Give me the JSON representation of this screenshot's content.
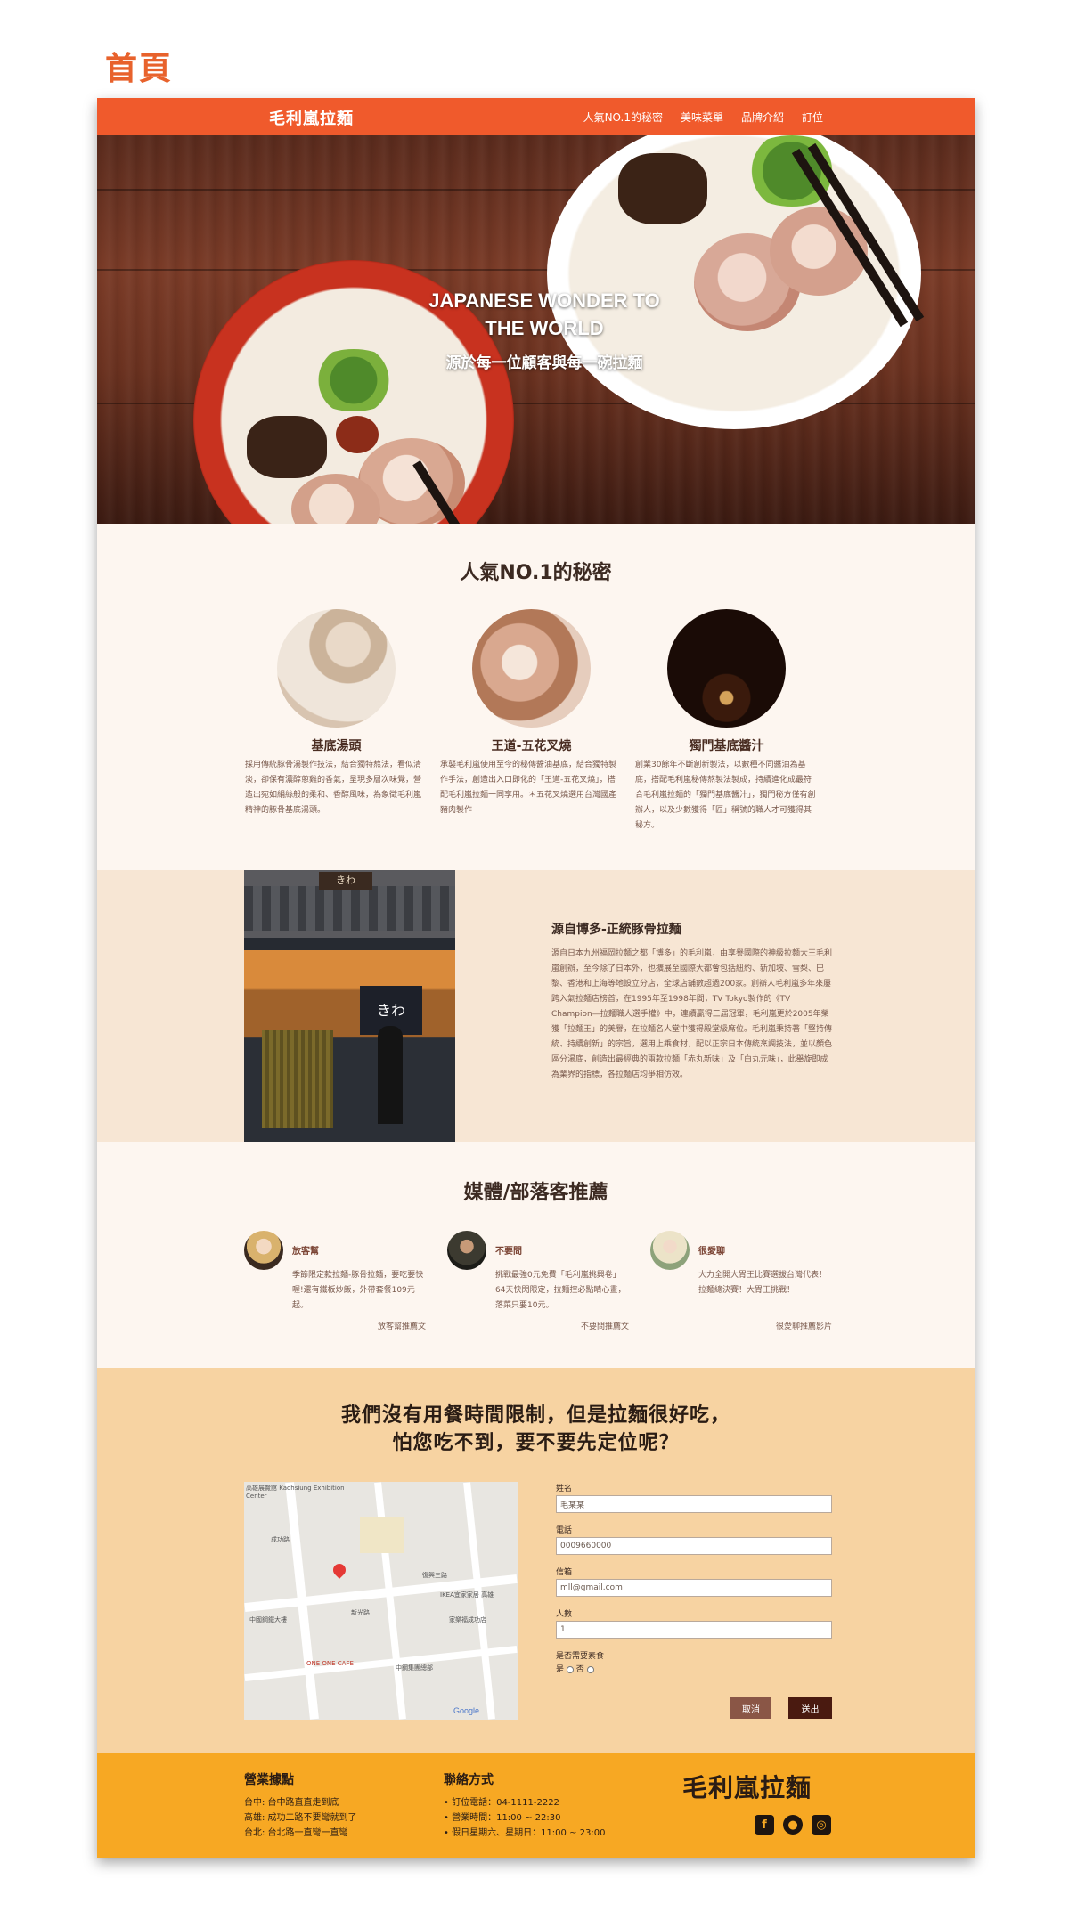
{
  "page_label": "首頁",
  "nav": {
    "brand": "毛利嵐拉麵",
    "items": [
      {
        "label": "人氣NO.1的秘密"
      },
      {
        "label": "美味菜單"
      },
      {
        "label": "品牌介紹"
      },
      {
        "label": "訂位"
      }
    ]
  },
  "hero": {
    "title_line1": "JAPANESE WONDER TO",
    "title_line2": "THE WORLD",
    "subtitle": "源於每一位顧客與每一碗拉麵"
  },
  "secret": {
    "title": "人氣NO.1的秘密",
    "features": [
      {
        "name": "基底湯頭",
        "desc": "採用傳統豚骨湯製作技法，結合獨特熬法，看似清淡，卻保有濃醇蔥雞的香氣，呈現多層次味覺，營造出宛如絹絲般的柔和、香醇風味，為象徵毛利嵐精神的豚骨基底湯頭。"
      },
      {
        "name": "王道-五花叉燒",
        "desc": "承襲毛利嵐使用至今的秘傳醬油基底，結合獨特製作手法，創造出入口即化的「王道-五花叉燒」，搭配毛利嵐拉麵一同享用。＊五花叉燒選用台灣國產豬肉製作"
      },
      {
        "name": "獨門基底醬汁",
        "desc": "創業30餘年不斷創新製法，以數種不同醬油為基底，搭配毛利嵐秘傳熬製法製成，持續進化成最符合毛利嵐拉麵的「獨門基底醬汁」，獨門秘方僅有創辦人，以及少數獲得「匠」稱號的職人才可獲得其秘方。"
      }
    ]
  },
  "story": {
    "shop_sign": "きわ",
    "title": "源自博多-正統豚骨拉麵",
    "text": "源自日本九州福岡拉麵之都「博多」的毛利嵐，由享譽國際的神級拉麵大王毛利嵐創辦，至今除了日本外，也擴展至國際大都會包括紐約、新加坡、雪梨、巴黎、香港和上海等地設立分店，全球店舖數超過200家。創辦人毛利嵐多年來屢跨入氣拉麵店榜首，在1995年至1998年間，TV Tokyo製作的《TV Champion—拉麵職人選手權》中，連續贏得三屆冠軍，毛利嵐更於2005年榮獲「拉麵王」的美譽，在拉麵名人堂中獲得殿堂級席位。毛利嵐秉持著「堅持傳統、持續創新」的宗旨，選用上乘食材，配以正宗日本傳統烹調技法，並以顏色區分湯底，創造出最經典的兩款拉麵「赤丸新味」及「白丸元味」，此舉旋即成為業界的指標，各拉麵店均爭相仿效。"
  },
  "media": {
    "title": "媒體/部落客推薦",
    "reviews": [
      {
        "name": "放客幫",
        "text": "季節限定款拉麵-豚骨拉麵，要吃要快喔!還有鐵板炒飯，外帶套餐109元起。",
        "link": "放客幫推薦文"
      },
      {
        "name": "不要問",
        "text": "挑戰最強0元免費「毛利嵐挑興卷」64天快閃限定，拉麵控必點睛心畫，落菜只要10元。",
        "link": "不要問推薦文"
      },
      {
        "name": "很愛聊",
        "text": "大力全開大胃王比賽選拔台灣代表！拉麵總決賽！大胃王挑戰！",
        "link": "很愛聊推薦影片"
      }
    ]
  },
  "reservation": {
    "title_line1": "我們沒有用餐時間限制，但是拉麵很好吃，",
    "title_line2": "怕您吃不到，要不要先定位呢？",
    "map": {
      "labels": [
        "高雄展覽館 Kaohsiung Exhibition Center",
        "成功路",
        "復興三路",
        "新光路",
        "IKEA宜家家居 高雄",
        "中國鋼鐵大樓",
        "ONE ONE CAFE",
        "中鋼集團總部",
        "家樂福成功店",
        "Google"
      ]
    },
    "form": {
      "name_label": "姓名",
      "name_value": "毛某某",
      "phone_label": "電話",
      "phone_value": "0009660000",
      "email_label": "信箱",
      "email_value": "mll@gmail.com",
      "people_label": "人數",
      "people_value": "1",
      "veg_label": "是否需要素食",
      "veg_yes": "是",
      "veg_no": "否",
      "cancel": "取消",
      "submit": "送出"
    }
  },
  "footer": {
    "locations_title": "營業據點",
    "locations": [
      "台中: 台中路直直走到底",
      "高雄: 成功二路不要彎就到了",
      "台北: 台北路一直彎一直彎"
    ],
    "contact_title": "聯絡方式",
    "contact": [
      "• 訂位電話：04-1111-2222",
      "• 營業時間：11:00 ~ 22:30",
      "• 假日星期六、星期日：11:00 ~ 23:00"
    ],
    "brand": "毛利嵐拉麵"
  },
  "colors": {
    "nav": "#f05a2c",
    "page_label": "#e8622c",
    "story_bg": "#f7e6d4",
    "reserve_bg": "#f7d3a2",
    "footer": "#f7a823",
    "cancel_btn": "#8a5646",
    "submit_btn": "#4a1a10"
  }
}
